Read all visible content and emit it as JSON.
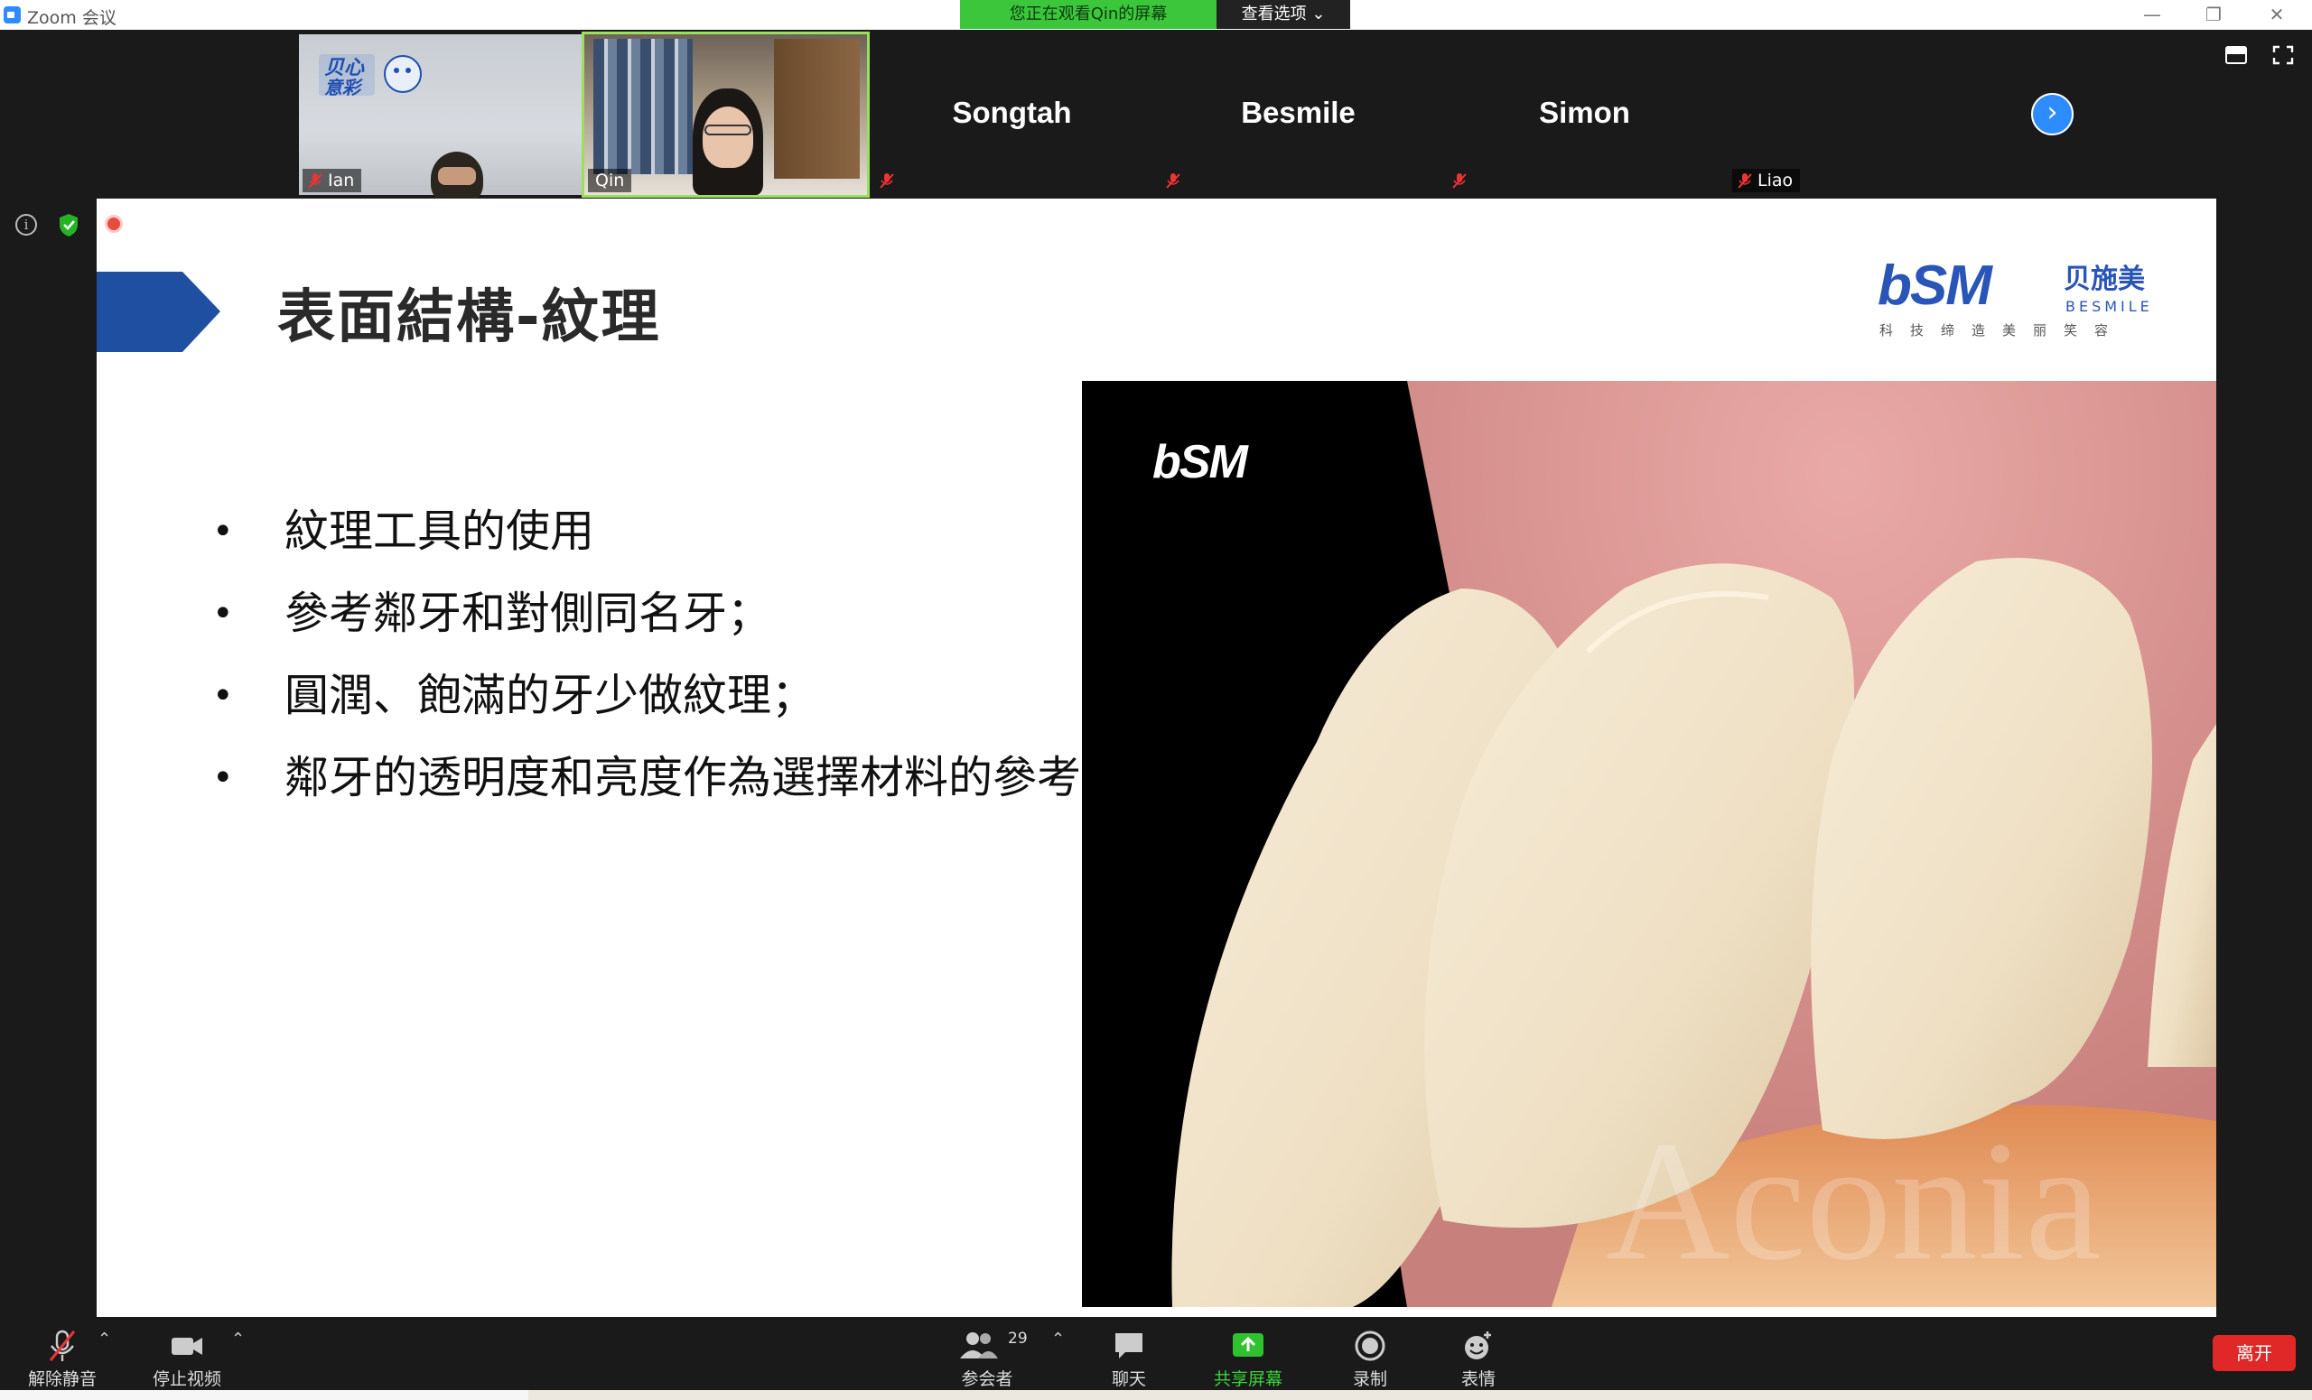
{
  "window": {
    "app_title": "Zoom 会议",
    "viewing_banner": "您正在观看Qin的屏幕",
    "view_options_label": "查看选项"
  },
  "participants": [
    {
      "name": "Ian",
      "muted": true,
      "video": true
    },
    {
      "name": "Qin",
      "muted": false,
      "video": true,
      "active_speaker": true
    },
    {
      "name": "Songtah",
      "muted": true,
      "video": false
    },
    {
      "name": "Besmile",
      "muted": true,
      "video": false
    },
    {
      "name": "Simon",
      "muted": true,
      "video": false
    },
    {
      "name": "Liao",
      "muted": true,
      "video": false
    }
  ],
  "slide": {
    "title": "表面結構-紋理",
    "logo": {
      "mark": "bSM",
      "cn": "贝施美",
      "en": "BESMILE",
      "slogan": "科 技 缔 造 美 丽 笑 容"
    },
    "bullets": [
      "紋理工具的使用",
      "參考鄰牙和對側同名牙；",
      "圓潤、飽滿的牙少做紋理；",
      "鄰牙的透明度和亮度作為選擇材料的參考。"
    ],
    "photo_logo": "bSM",
    "photo_watermark": "Aconia"
  },
  "toolbar": {
    "unmute_label": "解除静音",
    "stop_video_label": "停止视频",
    "participants_label": "参会者",
    "participants_count": "29",
    "chat_label": "聊天",
    "share_label": "共享屏幕",
    "record_label": "录制",
    "reactions_label": "表情",
    "leave_label": "离开"
  },
  "colors": {
    "share_green": "#3cc63c",
    "zoom_blue": "#2d8cff",
    "leave_red": "#e02828",
    "slide_accent": "#1f4fa0"
  }
}
